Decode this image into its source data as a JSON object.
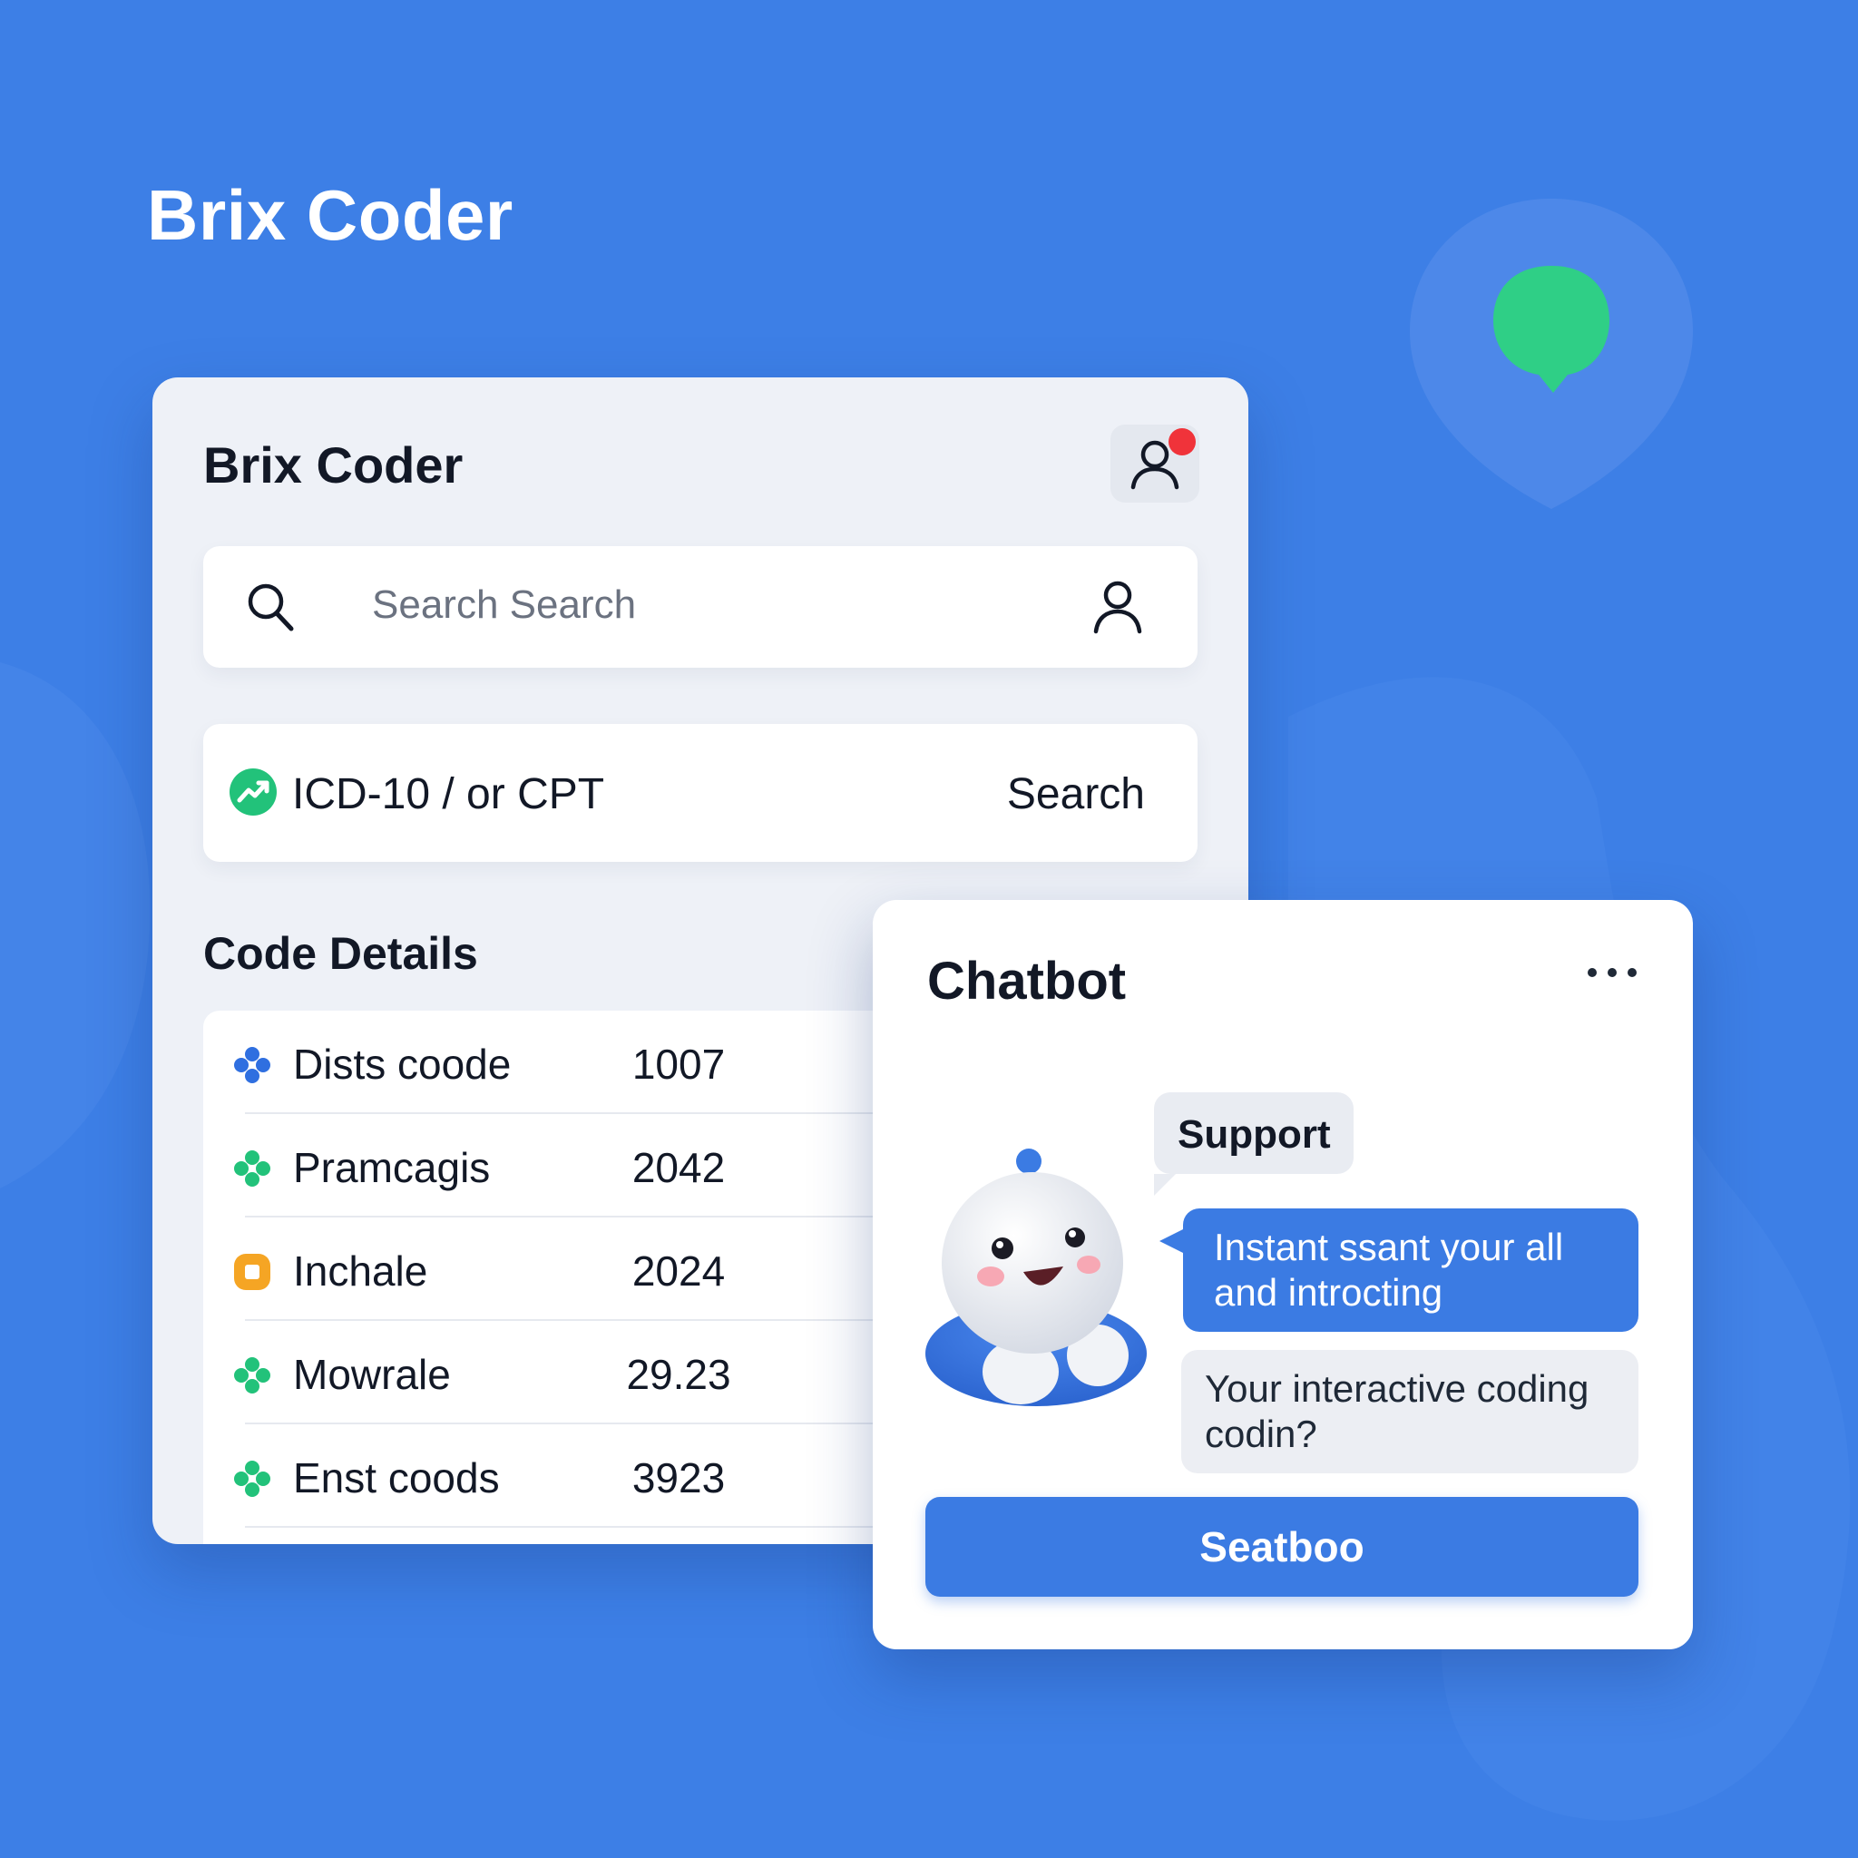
{
  "hero": {
    "title": "Brix Coder"
  },
  "coder_panel": {
    "title": "Brix Coder",
    "search": {
      "placeholder": "Search Search"
    },
    "code_search": {
      "label": "ICD-10 / or CPT",
      "button": "Search"
    },
    "section_title": "Code Details",
    "codes": [
      {
        "name": "Dists coode",
        "value": "1007",
        "icon": "blue-cross-icon",
        "color": "#2f6fe0"
      },
      {
        "name": "Pramcagis",
        "value": "2042",
        "icon": "green-cross-icon",
        "color": "#22c27a"
      },
      {
        "name": "Inchale",
        "value": "2024",
        "icon": "orange-square-icon",
        "color": "#f5a524"
      },
      {
        "name": "Mowrale",
        "value": "29.23",
        "icon": "green-cross-icon",
        "color": "#22c27a"
      },
      {
        "name": "Enst coods",
        "value": "3923",
        "icon": "green-cross-icon",
        "color": "#22c27a"
      }
    ]
  },
  "chatbot": {
    "title": "Chatbot",
    "support_label": "Support",
    "bot_message": "Instant ssant your all and introcting",
    "user_message": "Your interactive coding codin?",
    "button": "Seatboo"
  },
  "colors": {
    "background": "#3d7fe6",
    "accent": "#3b7be3",
    "notification": "#f0333a",
    "success": "#22c27a",
    "badge_green": "#2fcf86"
  }
}
